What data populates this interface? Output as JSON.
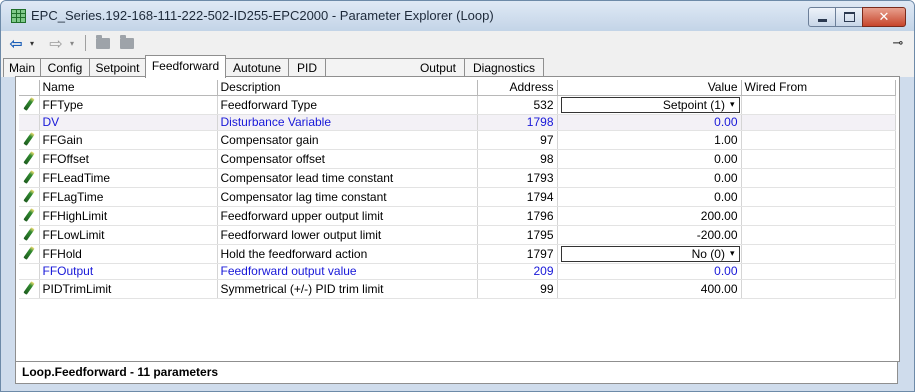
{
  "window": {
    "title": "EPC_Series.192-168-111-222-502-ID255-EPC2000 - Parameter Explorer (Loop)"
  },
  "toolbar": {
    "back_icon": "back-arrow-icon",
    "forward_icon": "forward-arrow-icon",
    "dropdown_glyph": "▾",
    "back_glyph": "⇦",
    "forward_glyph": "⇨",
    "pin_glyph": "⊸"
  },
  "tabs": [
    {
      "label": "Main"
    },
    {
      "label": "Config"
    },
    {
      "label": "Setpoint"
    },
    {
      "label": "Feedforward",
      "active": true
    },
    {
      "label": "Autotune"
    },
    {
      "label": "PID"
    },
    {
      "label": "Output"
    },
    {
      "label": "Diagnostics"
    }
  ],
  "table": {
    "headers": {
      "name": "Name",
      "description": "Description",
      "address": "Address",
      "value": "Value",
      "wired_from": "Wired From"
    },
    "rows": [
      {
        "name": "FFType",
        "description": "Feedforward Type",
        "address": "532",
        "value": "Setpoint (1)",
        "editable": true,
        "dropdown": true,
        "readonly": false
      },
      {
        "name": "DV",
        "description": "Disturbance Variable",
        "address": "1798",
        "value": "0.00",
        "editable": false,
        "dropdown": false,
        "readonly": true
      },
      {
        "name": "FFGain",
        "description": "Compensator gain",
        "address": "97",
        "value": "1.00",
        "editable": true,
        "dropdown": false,
        "readonly": false
      },
      {
        "name": "FFOffset",
        "description": "Compensator offset",
        "address": "98",
        "value": "0.00",
        "editable": true,
        "dropdown": false,
        "readonly": false
      },
      {
        "name": "FFLeadTime",
        "description": "Compensator lead time constant",
        "address": "1793",
        "value": "0.00",
        "editable": true,
        "dropdown": false,
        "readonly": false
      },
      {
        "name": "FFLagTime",
        "description": "Compensator lag time constant",
        "address": "1794",
        "value": "0.00",
        "editable": true,
        "dropdown": false,
        "readonly": false
      },
      {
        "name": "FFHighLimit",
        "description": "Feedforward upper output limit",
        "address": "1796",
        "value": "200.00",
        "editable": true,
        "dropdown": false,
        "readonly": false
      },
      {
        "name": "FFLowLimit",
        "description": "Feedforward lower output limit",
        "address": "1795",
        "value": "-200.00",
        "editable": true,
        "dropdown": false,
        "readonly": false
      },
      {
        "name": "FFHold",
        "description": "Hold the feedforward action",
        "address": "1797",
        "value": "No (0)",
        "editable": true,
        "dropdown": true,
        "readonly": false
      },
      {
        "name": "FFOutput",
        "description": "Feedforward output value",
        "address": "209",
        "value": "0.00",
        "editable": false,
        "dropdown": false,
        "readonly": true
      },
      {
        "name": "PIDTrimLimit",
        "description": "Symmetrical  (+/-) PID trim limit",
        "address": "99",
        "value": "400.00",
        "editable": true,
        "dropdown": false,
        "readonly": false
      }
    ]
  },
  "status": {
    "text": "Loop.Feedforward  -  11 parameters"
  },
  "colors": {
    "readonly_text": "#1818d8",
    "close_button": "#c7452b"
  }
}
